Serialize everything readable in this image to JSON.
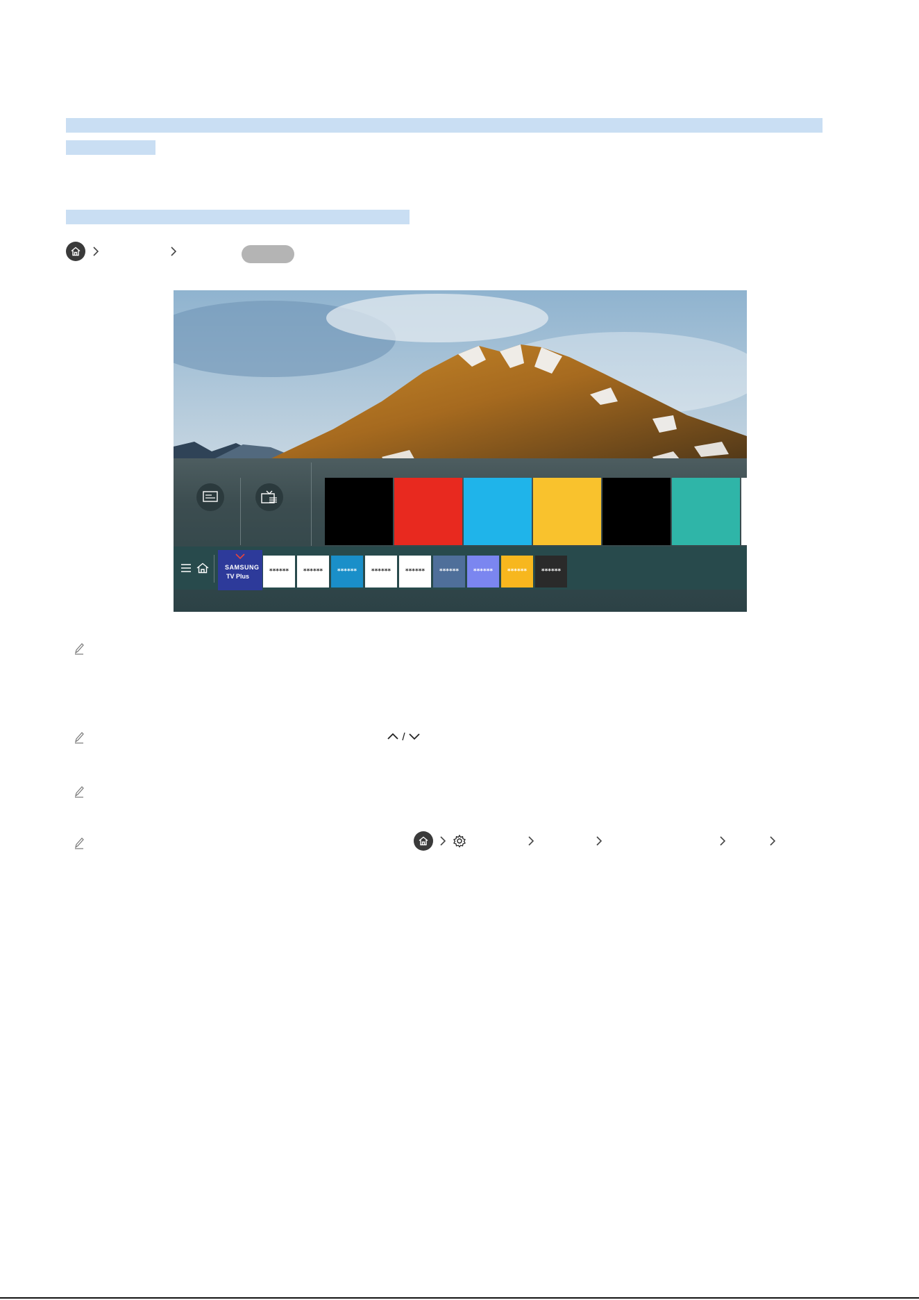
{
  "navigation": {
    "icons": [
      "home-icon",
      "chevron-right-icon",
      "chevron-right-icon"
    ]
  },
  "figure": {
    "app_bar": {
      "featured_app_line1": "SAMSUNG",
      "featured_app_line2": "TV Plus",
      "placeholder_apps": [
        "******",
        "******",
        "******",
        "******",
        "******",
        "******",
        "******",
        "******",
        "******"
      ]
    },
    "tile_colors": [
      "#000000",
      "#e8291f",
      "#1fb4ea",
      "#f9c22d",
      "#000000",
      "#2fb5a8"
    ],
    "app_colors": [
      "#ffffff",
      "#ffffff",
      "#1a8fc9",
      "#ffffff",
      "#ffffff",
      "#4f6f9a",
      "#7b86f0",
      "#f7b71e",
      "#2a2a2a"
    ]
  },
  "notes": {
    "icons": [
      "pencil-icon",
      "caret-up-icon",
      "caret-down-icon",
      "home-icon",
      "gear-icon"
    ]
  },
  "colors": {
    "highlight": "#c9def3",
    "home_button": "#3a3a3a"
  }
}
